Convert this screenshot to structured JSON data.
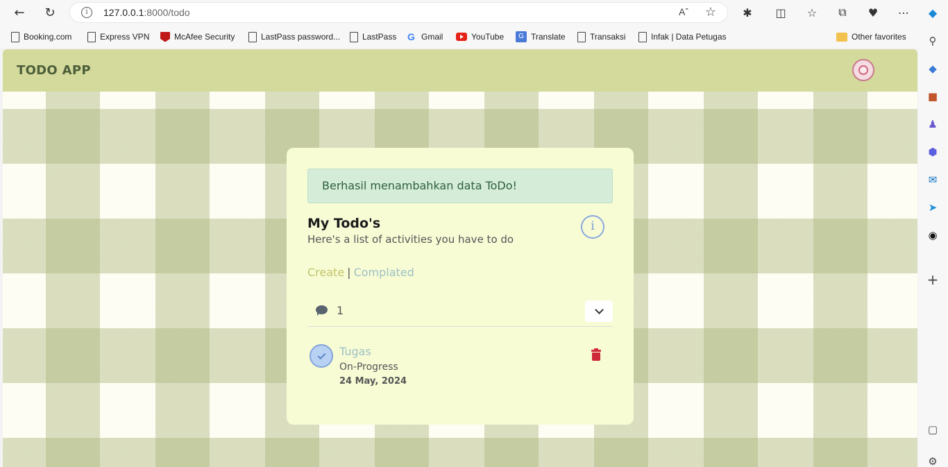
{
  "browser": {
    "url_host": "127.0.0.1",
    "url_path": ":8000/todo",
    "bookmarks": [
      "Booking.com",
      "Express VPN",
      "McAfee Security",
      "LastPass password...",
      "LastPass",
      "Gmail",
      "YouTube",
      "Translate",
      "Transaksi",
      "Infak | Data Petugas"
    ],
    "other_favorites": "Other favorites"
  },
  "app": {
    "brand": "TODO APP"
  },
  "card": {
    "alert": "Berhasil menambahkan data ToDo!",
    "title": "My Todo's",
    "subtitle": "Here's a list of activities you have to do",
    "info_glyph": "i",
    "nav": {
      "create": "Create",
      "separator": "|",
      "completed": "Complated"
    },
    "count": "1",
    "items": [
      {
        "title": "Tugas",
        "status": "On-Progress",
        "date": "24 May, 2024",
        "checked": true
      }
    ]
  },
  "colors": {
    "header": "#d4d99c",
    "card": "#f7fcd5",
    "alert_bg": "#d4ecd8",
    "delete": "#cf2a3a"
  }
}
